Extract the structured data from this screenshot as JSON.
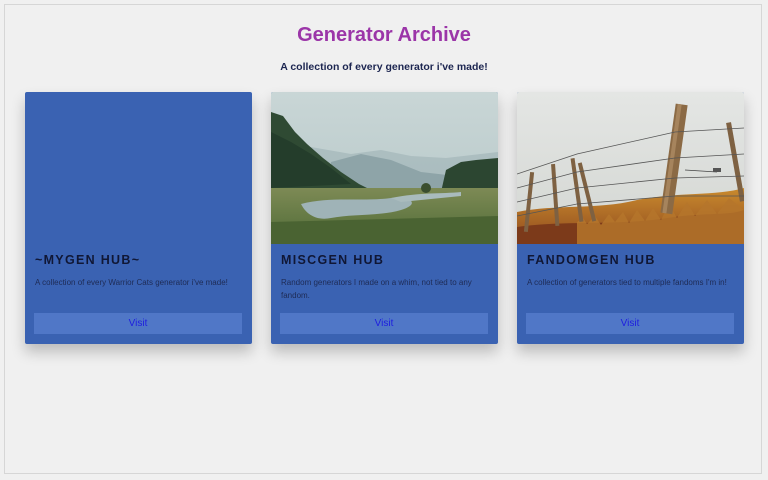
{
  "header": {
    "title": "Generator Archive",
    "subtitle": "A collection of every generator i've made!"
  },
  "colors": {
    "title": "#9b35a8",
    "card_bg": "#3a62b2",
    "button_bg": "#5077c7",
    "button_text": "#1d1de0"
  },
  "cards": [
    {
      "title": "~MYGEN HUB~",
      "description": "A collection of every Warrior Cats generator i've made!",
      "button_label": "Visit",
      "image": "none"
    },
    {
      "title": "MISCGEN HUB",
      "description": "Random generators I made on a whim, not tied to any fandom.",
      "button_label": "Visit",
      "image": "misty-lake-landscape"
    },
    {
      "title": "FANDOMGEN HUB",
      "description": "A collection of generators tied to multiple fandoms I'm in!",
      "button_label": "Visit",
      "image": "barbed-wire-fence-field"
    }
  ]
}
